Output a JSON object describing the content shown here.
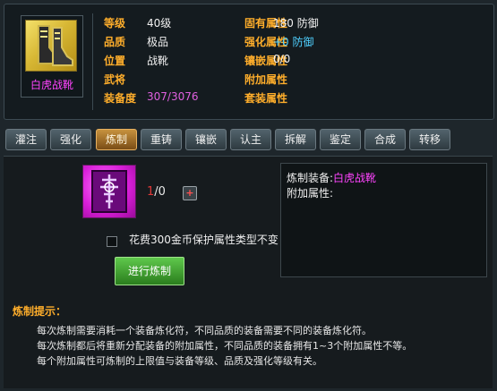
{
  "item": {
    "name": "白虎战靴",
    "stats": [
      {
        "label": "等级",
        "value": "40级"
      },
      {
        "label": "品质",
        "value": "极品"
      },
      {
        "label": "位置",
        "value": "战靴"
      },
      {
        "label": "武将",
        "value": ""
      },
      {
        "label": "装备度",
        "value": "307/3076"
      }
    ],
    "attrs": [
      {
        "label": "固有属性",
        "value": "180 防御"
      },
      {
        "label": "强化属性",
        "value": "+0 防御"
      },
      {
        "label": "镶嵌属性",
        "value": "0/0"
      },
      {
        "label": "附加属性",
        "value": ""
      },
      {
        "label": "套装属性",
        "value": ""
      }
    ]
  },
  "tabs": [
    "灌注",
    "强化",
    "炼制",
    "重铸",
    "镶嵌",
    "认主",
    "拆解",
    "鉴定",
    "合成",
    "转移"
  ],
  "active_tab_index": 2,
  "refine": {
    "count_current": "1",
    "count_total": "/0",
    "plus_label": "+",
    "protect_text": "花费300金币保护属性类型不变",
    "button_label": "进行炼制",
    "info_equip_label": "炼制装备:",
    "info_equip_value": "白虎战靴",
    "info_attr_label": "附加属性:"
  },
  "tips": {
    "title": "炼制提示：",
    "lines": [
      "每次炼制需要消耗一个装备炼化符，不同品质的装备需要不同的装备炼化符。",
      "每次炼制都后将重新分配装备的附加属性，不同品质的装备拥有1~3个附加属性不等。",
      "每个附加属性可炼制的上限值与装备等级、品质及强化等级有关。"
    ]
  },
  "colors": {
    "label": "#ffae2b",
    "item_name": "#ff44ff",
    "durability": "#e060e0",
    "enhance_value": "#4fd0ff",
    "active_tab": "#c7923e",
    "refine_button": "#3fa52f"
  },
  "icons": {
    "item": "boots-icon",
    "recipe": "refine-talisman-icon",
    "plus": "plus-icon"
  }
}
